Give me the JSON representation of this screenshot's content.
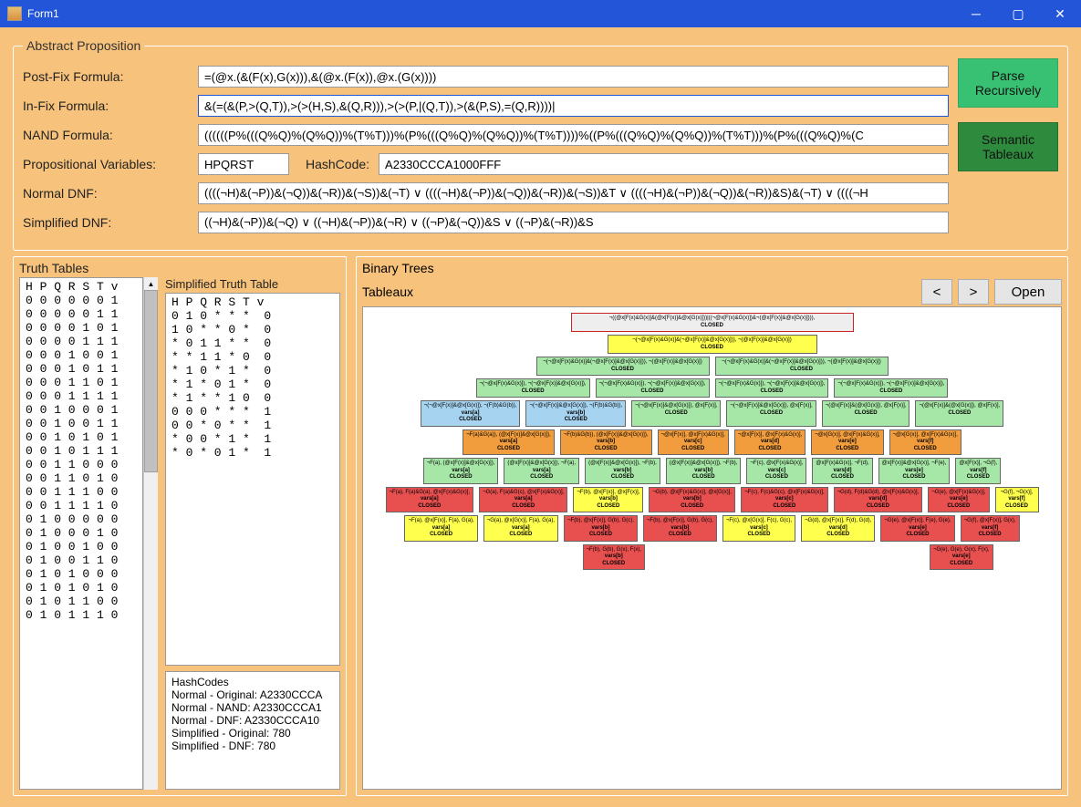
{
  "window": {
    "title": "Form1"
  },
  "abstract": {
    "legend": "Abstract Proposition",
    "labels": {
      "postfix": "Post-Fix Formula:",
      "infix": "In-Fix Formula:",
      "nand": "NAND Formula:",
      "propvars": "Propositional Variables:",
      "hashcode": "HashCode:",
      "ndnf": "Normal DNF:",
      "sdnf": "Simplified DNF:"
    },
    "values": {
      "postfix": "=(@x.(&(F(x),G(x))),&(@x.(F(x)),@x.(G(x))))",
      "infix": "&(=(&(P,>(Q,T)),>(>(H,S),&(Q,R))),>(>(P,|(Q,T)),>(&(P,S),=(Q,R))))|",
      "nand": "((((((P%(((Q%Q)%(Q%Q))%(T%T)))%(P%(((Q%Q)%(Q%Q))%(T%T))))%((P%(((Q%Q)%(Q%Q))%(T%T)))%(P%(((Q%Q)%(C",
      "propvars": "HPQRST",
      "hashcode": "A2330CCCA1000FFF",
      "ndnf": "((((¬H)&(¬P))&(¬Q))&(¬R))&(¬S))&(¬T) ∨ ((((¬H)&(¬P))&(¬Q))&(¬R))&(¬S))&T ∨ ((((¬H)&(¬P))&(¬Q))&(¬R))&S)&(¬T) ∨ ((((¬H",
      "sdnf": "((¬H)&(¬P))&(¬Q) ∨ ((¬H)&(¬P))&(¬R) ∨ ((¬P)&(¬Q))&S ∨ ((¬P)&(¬R))&S"
    },
    "buttons": {
      "parse": "Parse Recursively",
      "tableaux": "Semantic Tableaux"
    }
  },
  "truth": {
    "title": "Truth Tables",
    "simplified_title": "Simplified Truth Table",
    "header": "H P Q R S T v",
    "rows": [
      "0 0 0 0 0 0 1",
      "0 0 0 0 0 1 1",
      "0 0 0 0 1 0 1",
      "0 0 0 0 1 1 1",
      "0 0 0 1 0 0 1",
      "0 0 0 1 0 1 1",
      "0 0 0 1 1 0 1",
      "0 0 0 1 1 1 1",
      "0 0 1 0 0 0 1",
      "0 0 1 0 0 1 1",
      "0 0 1 0 1 0 1",
      "0 0 1 0 1 1 1",
      "0 0 1 1 0 0 0",
      "0 0 1 1 0 1 0",
      "0 0 1 1 1 0 0",
      "0 0 1 1 1 1 0",
      "0 1 0 0 0 0 0",
      "0 1 0 0 0 1 0",
      "0 1 0 0 1 0 0",
      "0 1 0 0 1 1 0",
      "0 1 0 1 0 0 0",
      "0 1 0 1 0 1 0",
      "0 1 0 1 1 0 0",
      "0 1 0 1 1 1 0"
    ],
    "simplified_header": "H P Q R S T v",
    "simplified_rows": [
      "0 1 0 * * *  0",
      "1 0 * * 0 *  0",
      "* 0 1 1 * *  0",
      "* * 1 1 * 0  0",
      "* 1 0 * 1 *  0",
      "* 1 * 0 1 *  0",
      "* 1 * * 1 0  0",
      "0 0 0 * * *  1",
      "0 0 * 0 * *  1",
      "* 0 0 * 1 *  1",
      "* 0 * 0 1 *  1"
    ],
    "hash_title": "HashCodes",
    "hash_lines": [
      "Normal - Original: A2330CCCA",
      "Normal - NAND: A2330CCCA1",
      "Normal - DNF: A2330CCCA10",
      "Simplified - Original: 780",
      "Simplified - DNF: 780"
    ]
  },
  "binary": {
    "title": "Binary Trees",
    "subtitle": "Tableaux",
    "prev": "<",
    "next": ">",
    "open": "Open",
    "closed": "CLOSED",
    "node_vars": [
      "vars[a]",
      "vars[b]",
      "vars[c]",
      "vars[d]",
      "vars[e]",
      "vars[f]"
    ],
    "node_top": "¬((@x[F(x)&G(x)]&(@x[F(x)]&@x[G(x)]))|((¬@x[F(x)&G(x)])&¬(@x[F(x)]&@x[G(x)]))),",
    "node_sample_long": "¬(¬@x[F(x)&G(x)]&(¬@x[F(x)]&@x[G(x)])), ¬(@x[F(x)]&@x[G(x)])",
    "node_sample_short": "¬(¬@x[F(x)&G(x)]), ¬(¬@x[F(x)]&@x[G(x)]),",
    "node_fg_a": "¬F(a)&G(a)), (@x[F(x)]&@x[G(x)]),",
    "node_f_a": "¬F(a), (@x[F(x)]&@x[G(x)]),",
    "node_red_a": "¬F(a), F(a)&G(a), @x[F(x)&G(x)],",
    "node_yel_a": "¬F(a), @x[F(x)], F(a), G(a),"
  }
}
